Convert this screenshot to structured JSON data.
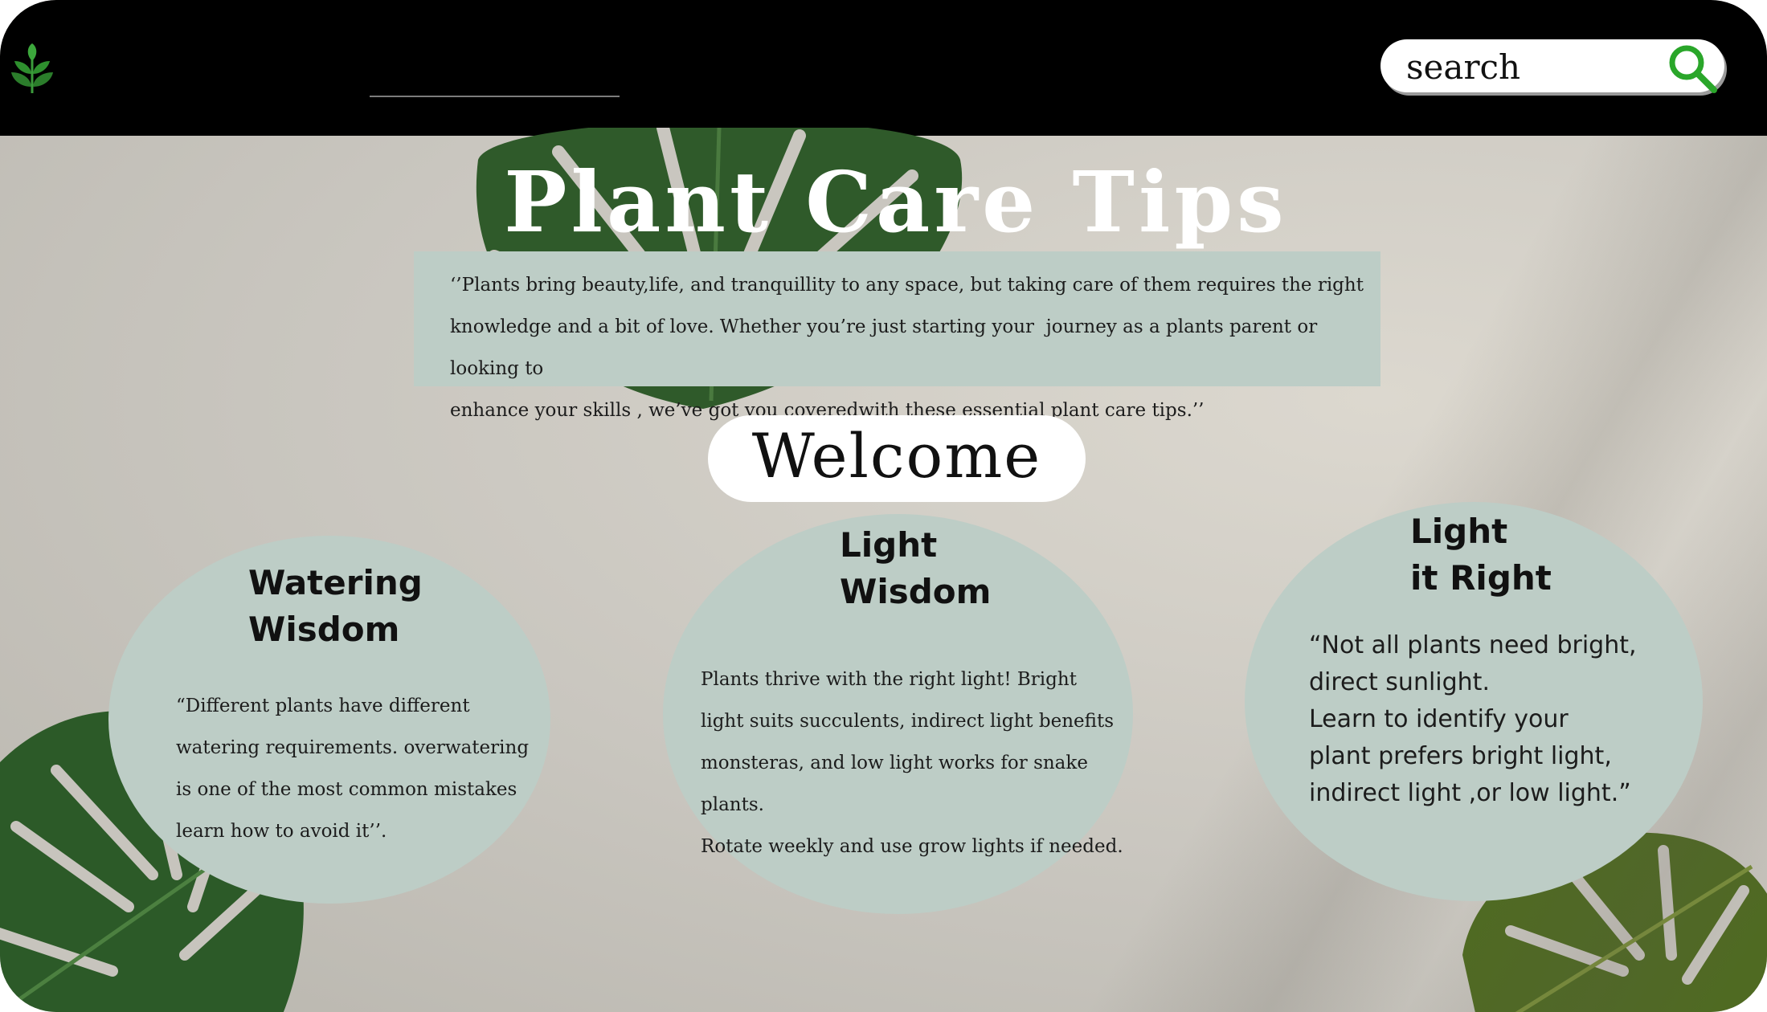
{
  "header": {
    "search": {
      "placeholder": "search",
      "icon": "search-icon"
    },
    "logo": "plant-logo-icon"
  },
  "hero": {
    "title": "Plant Care Tips",
    "intro": "‘’Plants bring beauty,life, and tranquillity to any space, but taking care of them requires the right\nknowledge and a bit of love. Whether you’re just starting your  journey as a plants parent or looking to\nenhance your skills , we’ve got you coveredwith these essential plant care tips.’’",
    "welcome_label": "Welcome"
  },
  "cards": [
    {
      "title": "Watering\nWisdom",
      "body": "“Different plants have different\nwatering requirements. overwatering\nis one of the most common mistakes\nlearn how to avoid it’’."
    },
    {
      "title": "Light\nWisdom",
      "body": "Plants thrive with the right light! Bright\nlight suits succulents, indirect light benefits\nmonsteras, and low light works for snake plants.\nRotate weekly and use grow lights if needed."
    },
    {
      "title": "Light\nit Right",
      "body": "“Not all plants need bright,\n direct sunlight.\n Learn to identify your\n plant prefers bright light,\n indirect light ,or low light.”"
    }
  ],
  "colors": {
    "topbar": "#000000",
    "card_fill": "#bdcdc6",
    "search_icon": "#2aa62a",
    "leaf": "#2f5a2a"
  }
}
